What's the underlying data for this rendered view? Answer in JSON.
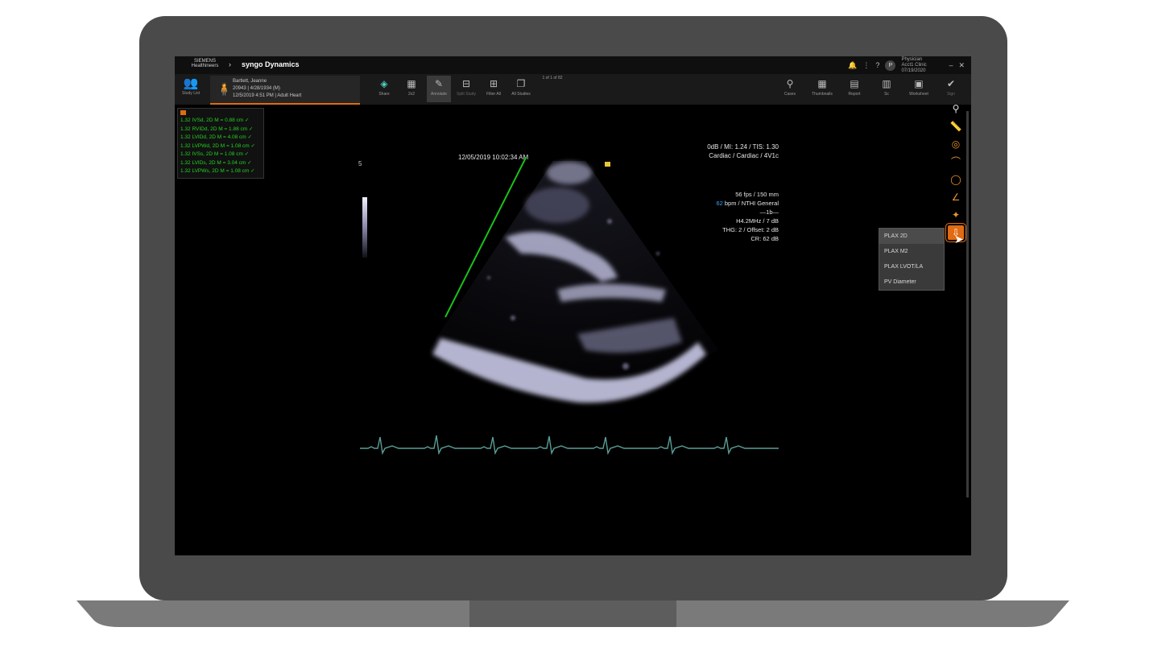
{
  "titlebar": {
    "brand": "SIEMENS Healthineers",
    "app_title": "syngo Dynamics",
    "user_initial": "P",
    "user_name": "Physician",
    "user_sub": "Acct1 Clinic 07/19/2020"
  },
  "toolbar": {
    "study_list_label": "Study List",
    "patient": {
      "line1": "Bartlett, Jeanne",
      "line2": "20943 | 4/28/1934 (M)",
      "line3": "12/5/2019 4:51 PM | Adult Heart"
    },
    "tools": [
      {
        "label": "Share",
        "icon": "share-icon"
      },
      {
        "label": "2x2",
        "icon": "grid-icon"
      },
      {
        "label": "Annotate",
        "icon": "pencil-icon"
      },
      {
        "label": "Split Study",
        "icon": "split-icon"
      },
      {
        "label": "Filter All",
        "icon": "filter-icon"
      },
      {
        "label": "All Studies",
        "icon": "stack-icon"
      },
      {
        "label": "1 of 1 of 82",
        "icon": ""
      }
    ],
    "right_tools": [
      {
        "label": "Cases",
        "icon": "probe-icon"
      },
      {
        "label": "Thumbnails",
        "icon": "thumbnails-icon"
      },
      {
        "label": "Report",
        "icon": "report-icon"
      },
      {
        "label": "Sc",
        "icon": "sc-icon"
      },
      {
        "label": "Worksheet",
        "icon": "worksheet-icon"
      },
      {
        "label": "Sign",
        "icon": "sign-icon"
      }
    ]
  },
  "measurements": [
    "1.32   IVSd, 2D M = 0.88 cm ✓",
    "1.32   RVIDd, 2D M = 1.88 cm ✓",
    "1.32   LVIDd, 2D M = 4.08 cm ✓",
    "1.32 LVPWd, 2D M = 1.08 cm ✓",
    "1.32   IVSs, 2D M = 1.08 cm ✓",
    "1.32   LVIDs, 2D M = 3.04 cm ✓",
    "1.32 LVPWs, 2D M = 1.08 cm ✓"
  ],
  "image": {
    "date": "12/05/2019 10:02:34 AM",
    "scale_label": "5",
    "info_top": [
      "0dB / MI: 1.24 / TIS: 1.30",
      "Cardiac / Cardiac / 4V1c"
    ],
    "info_mid": {
      "fps": "56 fps / 150 mm",
      "bpm_value": "62",
      "bpm_rest": " bpm / NTHI General",
      "sep": "—1b—",
      "line4": "H4.2MHz / 7 dB",
      "line5": "THG: 2 / Offset: 2 dB",
      "line6": "CR: 62 dB"
    }
  },
  "protocol_menu": {
    "items": [
      "PLAX 2D",
      "PLAX M2",
      "PLAX LVOT/LA",
      "PV Diameter"
    ]
  },
  "colors": {
    "accent": "#e06b12",
    "measurement_text": "#21d321",
    "ecg": "#5a9e96",
    "caliper_line": "#19c219"
  }
}
